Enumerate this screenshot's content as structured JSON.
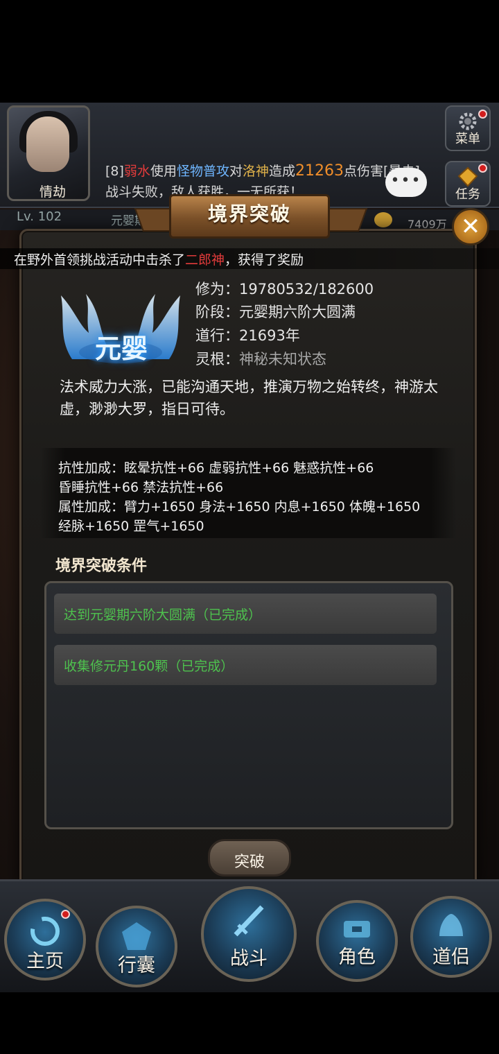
{
  "hud": {
    "avatar_label": "情劫",
    "menu_label": "菜单",
    "task_label": "任务",
    "log_line1": {
      "prefix": "[8]",
      "actor": "弱水",
      "verb1": "使用",
      "skill": "怪物普攻",
      "verb2": "对",
      "target": "洛神",
      "verb3": "造成",
      "damage": "21263",
      "suffix": "点伤害[暴击]"
    },
    "log_line2": "战斗失败，敌人获胜，一无所获！",
    "chat_dots": "•••",
    "level": "Lv. 102",
    "realm_short": "元婴期",
    "gold": "7409万"
  },
  "broadcast": {
    "prefix": "在野外首领挑战活动中击杀了",
    "boss": "二郎神",
    "suffix": "，获得了奖励"
  },
  "dialog": {
    "title": "境界突破",
    "close_icon": "✕",
    "emblem_text": "元婴",
    "stats": [
      {
        "label": "修为：",
        "value": "19780532/182600"
      },
      {
        "label": "阶段：",
        "value": "元婴期六阶大圆满"
      },
      {
        "label": "道行：",
        "value": "21693年"
      },
      {
        "label": "灵根：",
        "value": "神秘未知状态"
      }
    ],
    "description": "法术威力大涨，已能沟通天地，推演万物之始转终，神游太虚，渺渺大罗，指日可待。",
    "bonus_lines": [
      "抗性加成：眩晕抗性+66 虚弱抗性+66 魅惑抗性+66",
      "昏睡抗性+66 禁法抗性+66",
      "属性加成：臂力+1650 身法+1650 内息+1650 体魄+1650",
      "经脉+1650 罡气+1650"
    ],
    "conditions_title": "境界突破条件",
    "conditions": [
      "达到元婴期六阶大圆满（已完成）",
      "收集修元丹160颗（已完成）"
    ],
    "break_button": "突破"
  },
  "nav": [
    {
      "label": "主页",
      "icon": "home-icon"
    },
    {
      "label": "行囊",
      "icon": "bag-icon"
    },
    {
      "label": "战斗",
      "icon": "sword-icon"
    },
    {
      "label": "角色",
      "icon": "character-icon"
    },
    {
      "label": "道侣",
      "icon": "companion-icon"
    }
  ],
  "colors": {
    "condition_done": "#4ec24e",
    "emblem_glow": "#3aa8ff",
    "damage": "#e0b24a",
    "actor": "#e23b3b",
    "skill": "#6fb6ff"
  }
}
